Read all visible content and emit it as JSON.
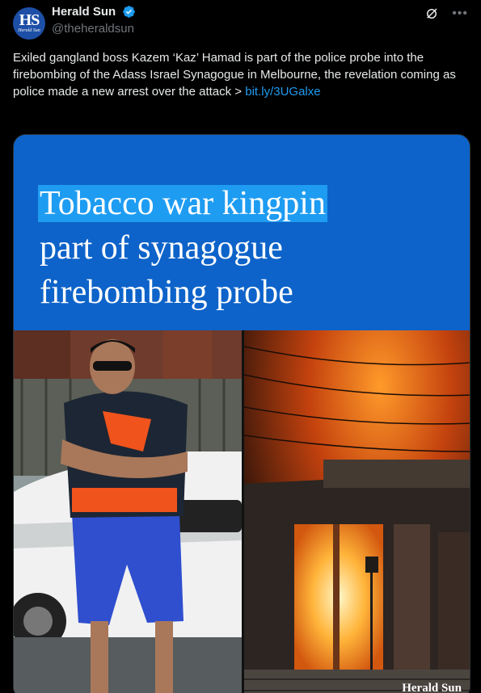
{
  "account": {
    "avatar_text": "HS",
    "avatar_subtext": "Herald Sun",
    "display_name": "Herald Sun",
    "handle": "@theheraldsun",
    "verified_icon": "verified-badge-icon"
  },
  "tweet": {
    "text": "Exiled gangland boss Kazem ‘Kaz’ Hamad is part of the police probe into the firebombing of the Adass Israel Synagogue in Melbourne, the revelation coming as police made a new arrest over the attack > ",
    "link": "bit.ly/3UGalxe"
  },
  "card": {
    "headline_line1": "Tobacco war kingpin",
    "headline_line2": "part of synagogue",
    "headline_line3": "firebombing probe",
    "watermark": "Herald Sun",
    "colors": {
      "headline_bg": "#0d63c9",
      "highlight": "#1e9cf2"
    }
  },
  "icons": {
    "grok": "grok-icon",
    "more": "more-icon"
  }
}
